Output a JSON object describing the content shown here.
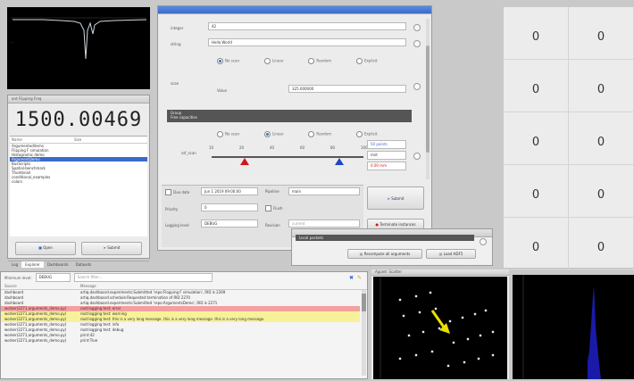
{
  "scope_top": {
    "trace_color": "#cfd8e0"
  },
  "flipping_window": {
    "title": "ant Flipping Freq",
    "counter": "1500.00469",
    "list_header": [
      "Name",
      "Size"
    ],
    "list_items": [
      "Argumenteditems",
      "Flipping F simulation",
      "Histogramic demo",
      "ArgumentDemo",
      "BusScripts",
      "Spatial-benchmark",
      "Thumbnail",
      "conditional_examples",
      "colors"
    ],
    "selected_index": 3,
    "open_label": "Open",
    "submit_label": "Submit",
    "tabs": [
      "Log",
      "Explorer",
      "Dashboards",
      "Datasets"
    ]
  },
  "argument_editor": {
    "title": "",
    "integer_label": "integer",
    "integer_value": "42",
    "string_label": "string",
    "string_value": "Hello World",
    "scan_modes": [
      "No scan",
      "Linear",
      "Random",
      "Explicit"
    ],
    "scan_label": "scan",
    "scan_value_label": "Value",
    "scan_value": "325.000000",
    "group_label": "Group",
    "group_sub": "Free capacities",
    "ranges_label": "ssf_scan",
    "slider_ticks": [
      "10",
      "20",
      "40",
      "60",
      "80",
      "100"
    ],
    "slider_min": 0.22,
    "slider_max": 0.84,
    "range_values": [
      "50 points",
      "mid",
      "0.00 mm"
    ],
    "due_date_label": "Due date",
    "due_date_value": "Jun 1 2019 09:00:00",
    "pipeline_label": "Pipeline",
    "pipeline_value": "main",
    "priority_label": "Priority",
    "priority_value": "0",
    "flush_label": "Flush",
    "logging_label": "Logging level",
    "logging_value": "DEBUG",
    "revision_label": "Revision",
    "revision_placeholder": "current",
    "submit_label": "Submit",
    "terminate_label": "Terminate instances"
  },
  "small_window": {
    "title": "",
    "tree_item": "Local packets",
    "recompute_label": "Recompute all arguments",
    "load_label": "Load HDF5"
  },
  "grid_panel": {
    "rows": [
      [
        {
          "label": "",
          "value": "0"
        },
        {
          "label": "",
          "value": "0"
        }
      ],
      [
        {
          "label": "",
          "value": "0"
        },
        {
          "label": "",
          "value": "0"
        }
      ],
      [
        {
          "label": "",
          "value": "0"
        },
        {
          "label": "",
          "value": "0"
        }
      ],
      [
        {
          "label": "",
          "value": "0"
        },
        {
          "label": "",
          "value": "0"
        }
      ],
      [
        {
          "label": "",
          "value": "0"
        },
        {
          "label": "",
          "value": "0"
        }
      ]
    ]
  },
  "log_panel": {
    "level_label": "Minimum level:",
    "level_value": "DEBUG",
    "filter_placeholder": "Search filter...",
    "col_source": "Source",
    "col_message": "Message",
    "rows": [
      {
        "source": "dashboard",
        "message": "artiq.dashboard.experiments:Submitted 'repo:Flopping F simulation', RID is 2269",
        "level": "info"
      },
      {
        "source": "dashboard",
        "message": "artiq.dashboard.schedule:Requested termination of RID 2270",
        "level": "info"
      },
      {
        "source": "dashboard",
        "message": "artiq.dashboard.experiments:Submitted 'repo:ArgumentsDemo', RID is 2271",
        "level": "info"
      },
      {
        "source": "worker(2271,arguments_demo.py)",
        "message": "root:logging test: error",
        "level": "error"
      },
      {
        "source": "worker(2271,arguments_demo.py)",
        "message": "root:logging test: warning",
        "level": "warning"
      },
      {
        "source": "worker(2271,arguments_demo.py)",
        "message": "root:logging test: this is a very long message. this is a very long message. this is a very long message.",
        "level": "warning"
      },
      {
        "source": "worker(2271,arguments_demo.py)",
        "message": "root:logging test: info",
        "level": "info"
      },
      {
        "source": "worker(2271,arguments_demo.py)",
        "message": "root:logging test: debug",
        "level": "info"
      },
      {
        "source": "worker(2271,arguments_demo.py)",
        "message": "print:42",
        "level": "info"
      },
      {
        "source": "worker(2271,arguments_demo.py)",
        "message": "print:True",
        "level": "info"
      }
    ]
  },
  "scatter_panel": {
    "title": "Applet: Scatter"
  },
  "colors": {
    "accent": "#3b6bc9",
    "error_row": "#f4a0a0",
    "warning_row": "#f7f29a",
    "bar": "#1a1aa8",
    "arrow": "#e8e000"
  }
}
